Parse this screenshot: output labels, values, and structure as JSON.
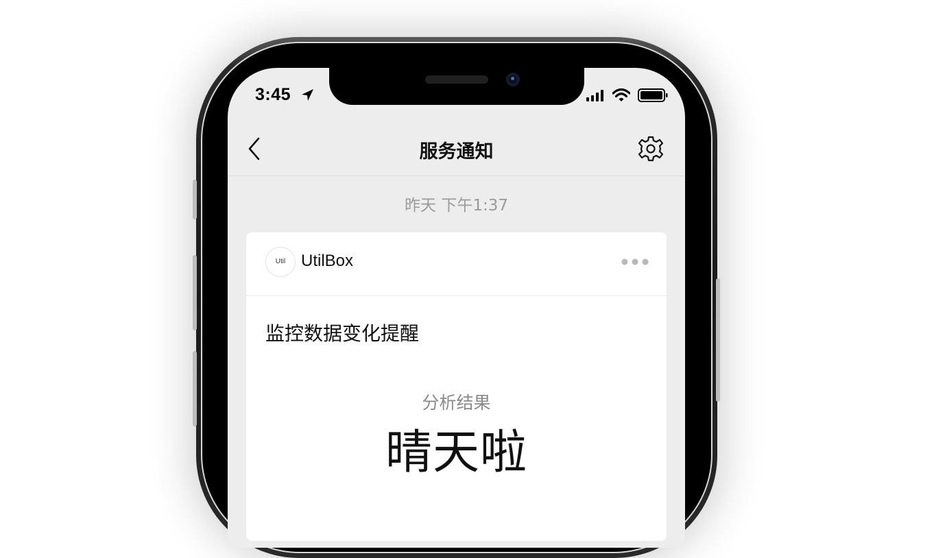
{
  "status_bar": {
    "time": "3:45",
    "icons": [
      "location-arrow-icon",
      "cellular-signal-icon",
      "wifi-icon",
      "battery-icon"
    ]
  },
  "nav": {
    "title": "服务通知",
    "back_icon": "chevron-left-icon",
    "settings_icon": "gear-icon"
  },
  "timestamp": "昨天 下午1:37",
  "card": {
    "app_avatar_text": "Util",
    "app_name": "UtilBox",
    "more_icon": "more-dots-icon",
    "message_title": "监控数据变化提醒",
    "result_label": "分析结果",
    "result_value": "晴天啦"
  },
  "colors": {
    "background": "#ededed",
    "card": "#ffffff",
    "muted_text": "#9b9b9b",
    "primary_text": "#111111"
  }
}
